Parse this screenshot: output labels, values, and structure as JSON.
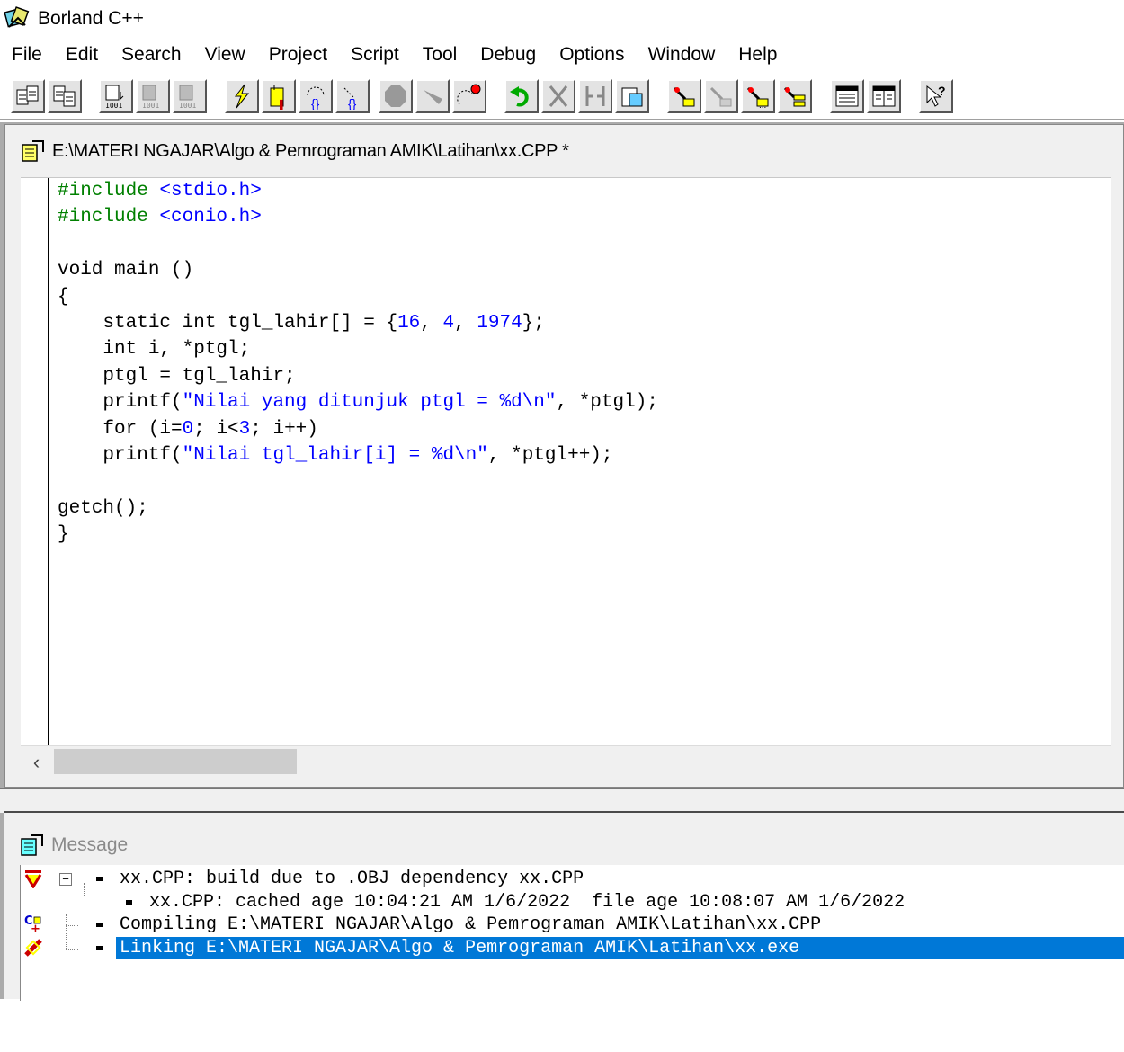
{
  "app": {
    "title": "Borland C++"
  },
  "menu": [
    "File",
    "Edit",
    "Search",
    "View",
    "Project",
    "Script",
    "Tool",
    "Debug",
    "Options",
    "Window",
    "Help"
  ],
  "toolbar": {
    "buttons": [
      {
        "icon": "open-project-icon"
      },
      {
        "icon": "close-project-icon"
      },
      {
        "icon": "compile-icon"
      },
      {
        "icon": "make-icon"
      },
      {
        "icon": "build-all-icon"
      },
      {
        "icon": "run-icon"
      },
      {
        "icon": "debug-run-icon"
      },
      {
        "icon": "step-over-icon"
      },
      {
        "icon": "trace-into-icon"
      },
      {
        "icon": "stop-icon"
      },
      {
        "icon": "pause-icon"
      },
      {
        "icon": "reset-icon"
      },
      {
        "icon": "undo-icon"
      },
      {
        "icon": "cut-icon"
      },
      {
        "icon": "copy-icon"
      },
      {
        "icon": "paste-icon"
      },
      {
        "icon": "toggle-breakpoint-icon"
      },
      {
        "icon": "inspect-icon"
      },
      {
        "icon": "evaluate-icon"
      },
      {
        "icon": "watch-icon"
      },
      {
        "icon": "tile-icon"
      },
      {
        "icon": "cascade-icon"
      },
      {
        "icon": "help-icon"
      }
    ]
  },
  "editor": {
    "title": "E:\\MATERI NGAJAR\\Algo & Pemrograman AMIK\\Latihan\\xx.CPP *",
    "lines": [
      [
        {
          "t": "#include ",
          "c": "pp"
        },
        {
          "t": "<stdio.h>",
          "c": "inc"
        }
      ],
      [
        {
          "t": "#include ",
          "c": "pp"
        },
        {
          "t": "<conio.h>",
          "c": "inc"
        }
      ],
      [],
      [
        {
          "t": "void main ()"
        }
      ],
      [
        {
          "t": "{"
        }
      ],
      [
        {
          "t": "    static int tgl_lahir[] = {"
        },
        {
          "t": "16",
          "c": "num"
        },
        {
          "t": ", "
        },
        {
          "t": "4",
          "c": "num"
        },
        {
          "t": ", "
        },
        {
          "t": "1974",
          "c": "num"
        },
        {
          "t": "};"
        }
      ],
      [
        {
          "t": "    int i, *ptgl;"
        }
      ],
      [
        {
          "t": "    ptgl = tgl_lahir;"
        }
      ],
      [
        {
          "t": "    printf("
        },
        {
          "t": "\"Nilai yang ditunjuk ptgl = %d\\n\"",
          "c": "str"
        },
        {
          "t": ", *ptgl);"
        }
      ],
      [
        {
          "t": "    for (i="
        },
        {
          "t": "0",
          "c": "num"
        },
        {
          "t": "; i<"
        },
        {
          "t": "3",
          "c": "num"
        },
        {
          "t": "; i++)"
        }
      ],
      [
        {
          "t": "    printf("
        },
        {
          "t": "\"Nilai tgl_lahir[i] = %d\\n\"",
          "c": "str"
        },
        {
          "t": ", *ptgl++);"
        }
      ],
      [],
      [
        {
          "t": "getch();"
        }
      ],
      [
        {
          "t": "}"
        }
      ]
    ]
  },
  "message": {
    "title": "Message",
    "rows": [
      {
        "text": "xx.CPP: build due to .OBJ dependency xx.CPP",
        "icon": "build-warning-icon",
        "indent": 0,
        "selected": false
      },
      {
        "text": "xx.CPP: cached age 10:04:21 AM 1/6/2022  file age 10:08:07 AM 1/6/2022",
        "icon": "",
        "indent": 1,
        "selected": false
      },
      {
        "text": "Compiling E:\\MATERI NGAJAR\\Algo & Pemrograman AMIK\\Latihan\\xx.CPP",
        "icon": "compile-icon",
        "indent": 0,
        "selected": false
      },
      {
        "text": "Linking E:\\MATERI NGAJAR\\Algo & Pemrograman AMIK\\Latihan\\xx.exe",
        "icon": "link-icon",
        "indent": 0,
        "selected": true
      }
    ]
  }
}
